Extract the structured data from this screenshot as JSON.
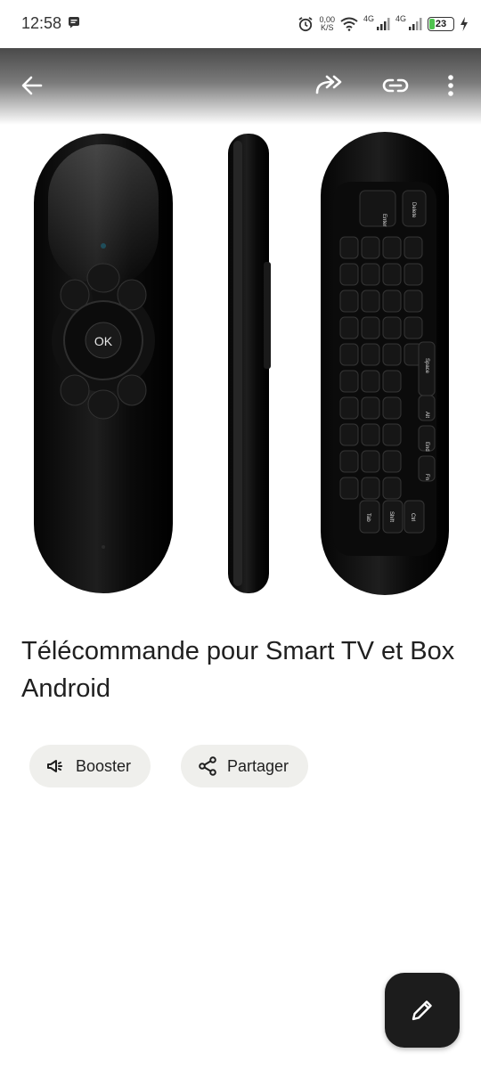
{
  "status_bar": {
    "time": "12:58",
    "net_speed_value": "0,00",
    "net_speed_unit": "K/S",
    "net_type_1": "4G",
    "net_type_2": "4G",
    "battery_level": "23",
    "battery_percent": 23
  },
  "toolbar": {
    "back_icon": "arrow-left-icon",
    "forward_icon": "forward-arrows-icon",
    "link_icon": "link-icon",
    "more_icon": "more-vertical-icon"
  },
  "post": {
    "title": "Télécommande pour Smart TV et Box Android"
  },
  "actions": {
    "boost_label": "Booster",
    "share_label": "Partager"
  },
  "remote": {
    "ok_label": "OK",
    "keyboard_top_keys": [
      "Enter",
      "Delete"
    ],
    "keyboard_bottom_keys": [
      "Tab",
      "Shift",
      "Ctrl"
    ],
    "keyboard_side_keys": [
      "Space",
      "Alt",
      "End",
      "Fn"
    ]
  },
  "fab": {
    "icon": "pencil-icon"
  },
  "colors": {
    "chip_bg": "#efefec",
    "fab_bg": "#1c1c1c",
    "battery_green": "#4fc34f"
  }
}
